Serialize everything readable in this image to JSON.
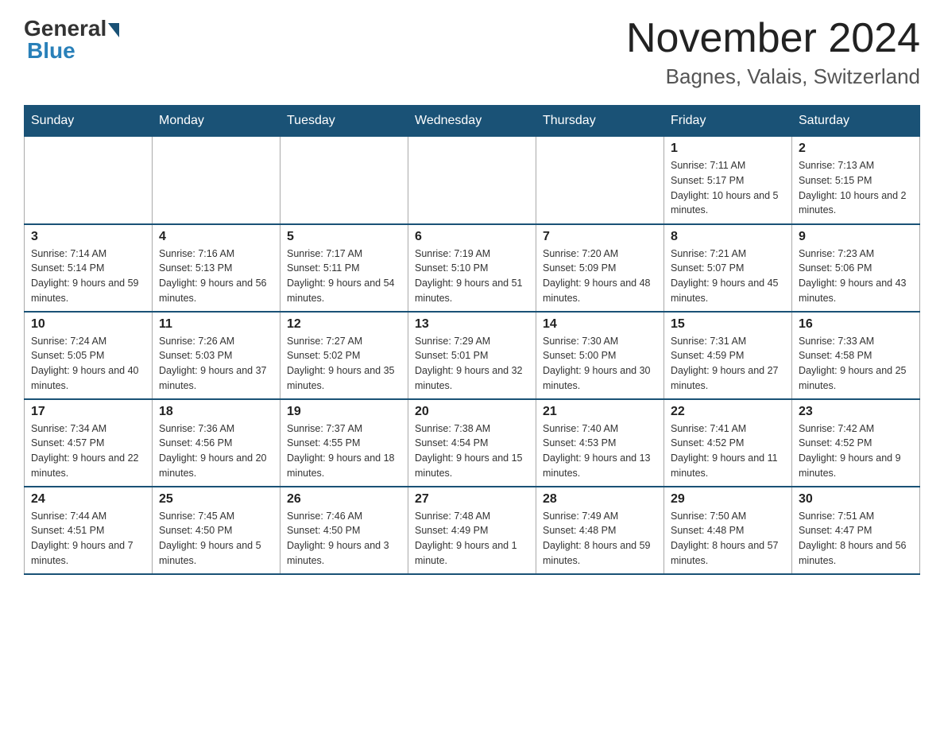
{
  "header": {
    "logo_general": "General",
    "logo_blue": "Blue",
    "month_title": "November 2024",
    "location": "Bagnes, Valais, Switzerland"
  },
  "days_of_week": [
    "Sunday",
    "Monday",
    "Tuesday",
    "Wednesday",
    "Thursday",
    "Friday",
    "Saturday"
  ],
  "weeks": [
    {
      "days": [
        {
          "num": "",
          "info": ""
        },
        {
          "num": "",
          "info": ""
        },
        {
          "num": "",
          "info": ""
        },
        {
          "num": "",
          "info": ""
        },
        {
          "num": "",
          "info": ""
        },
        {
          "num": "1",
          "info": "Sunrise: 7:11 AM\nSunset: 5:17 PM\nDaylight: 10 hours and 5 minutes."
        },
        {
          "num": "2",
          "info": "Sunrise: 7:13 AM\nSunset: 5:15 PM\nDaylight: 10 hours and 2 minutes."
        }
      ]
    },
    {
      "days": [
        {
          "num": "3",
          "info": "Sunrise: 7:14 AM\nSunset: 5:14 PM\nDaylight: 9 hours and 59 minutes."
        },
        {
          "num": "4",
          "info": "Sunrise: 7:16 AM\nSunset: 5:13 PM\nDaylight: 9 hours and 56 minutes."
        },
        {
          "num": "5",
          "info": "Sunrise: 7:17 AM\nSunset: 5:11 PM\nDaylight: 9 hours and 54 minutes."
        },
        {
          "num": "6",
          "info": "Sunrise: 7:19 AM\nSunset: 5:10 PM\nDaylight: 9 hours and 51 minutes."
        },
        {
          "num": "7",
          "info": "Sunrise: 7:20 AM\nSunset: 5:09 PM\nDaylight: 9 hours and 48 minutes."
        },
        {
          "num": "8",
          "info": "Sunrise: 7:21 AM\nSunset: 5:07 PM\nDaylight: 9 hours and 45 minutes."
        },
        {
          "num": "9",
          "info": "Sunrise: 7:23 AM\nSunset: 5:06 PM\nDaylight: 9 hours and 43 minutes."
        }
      ]
    },
    {
      "days": [
        {
          "num": "10",
          "info": "Sunrise: 7:24 AM\nSunset: 5:05 PM\nDaylight: 9 hours and 40 minutes."
        },
        {
          "num": "11",
          "info": "Sunrise: 7:26 AM\nSunset: 5:03 PM\nDaylight: 9 hours and 37 minutes."
        },
        {
          "num": "12",
          "info": "Sunrise: 7:27 AM\nSunset: 5:02 PM\nDaylight: 9 hours and 35 minutes."
        },
        {
          "num": "13",
          "info": "Sunrise: 7:29 AM\nSunset: 5:01 PM\nDaylight: 9 hours and 32 minutes."
        },
        {
          "num": "14",
          "info": "Sunrise: 7:30 AM\nSunset: 5:00 PM\nDaylight: 9 hours and 30 minutes."
        },
        {
          "num": "15",
          "info": "Sunrise: 7:31 AM\nSunset: 4:59 PM\nDaylight: 9 hours and 27 minutes."
        },
        {
          "num": "16",
          "info": "Sunrise: 7:33 AM\nSunset: 4:58 PM\nDaylight: 9 hours and 25 minutes."
        }
      ]
    },
    {
      "days": [
        {
          "num": "17",
          "info": "Sunrise: 7:34 AM\nSunset: 4:57 PM\nDaylight: 9 hours and 22 minutes."
        },
        {
          "num": "18",
          "info": "Sunrise: 7:36 AM\nSunset: 4:56 PM\nDaylight: 9 hours and 20 minutes."
        },
        {
          "num": "19",
          "info": "Sunrise: 7:37 AM\nSunset: 4:55 PM\nDaylight: 9 hours and 18 minutes."
        },
        {
          "num": "20",
          "info": "Sunrise: 7:38 AM\nSunset: 4:54 PM\nDaylight: 9 hours and 15 minutes."
        },
        {
          "num": "21",
          "info": "Sunrise: 7:40 AM\nSunset: 4:53 PM\nDaylight: 9 hours and 13 minutes."
        },
        {
          "num": "22",
          "info": "Sunrise: 7:41 AM\nSunset: 4:52 PM\nDaylight: 9 hours and 11 minutes."
        },
        {
          "num": "23",
          "info": "Sunrise: 7:42 AM\nSunset: 4:52 PM\nDaylight: 9 hours and 9 minutes."
        }
      ]
    },
    {
      "days": [
        {
          "num": "24",
          "info": "Sunrise: 7:44 AM\nSunset: 4:51 PM\nDaylight: 9 hours and 7 minutes."
        },
        {
          "num": "25",
          "info": "Sunrise: 7:45 AM\nSunset: 4:50 PM\nDaylight: 9 hours and 5 minutes."
        },
        {
          "num": "26",
          "info": "Sunrise: 7:46 AM\nSunset: 4:50 PM\nDaylight: 9 hours and 3 minutes."
        },
        {
          "num": "27",
          "info": "Sunrise: 7:48 AM\nSunset: 4:49 PM\nDaylight: 9 hours and 1 minute."
        },
        {
          "num": "28",
          "info": "Sunrise: 7:49 AM\nSunset: 4:48 PM\nDaylight: 8 hours and 59 minutes."
        },
        {
          "num": "29",
          "info": "Sunrise: 7:50 AM\nSunset: 4:48 PM\nDaylight: 8 hours and 57 minutes."
        },
        {
          "num": "30",
          "info": "Sunrise: 7:51 AM\nSunset: 4:47 PM\nDaylight: 8 hours and 56 minutes."
        }
      ]
    }
  ]
}
